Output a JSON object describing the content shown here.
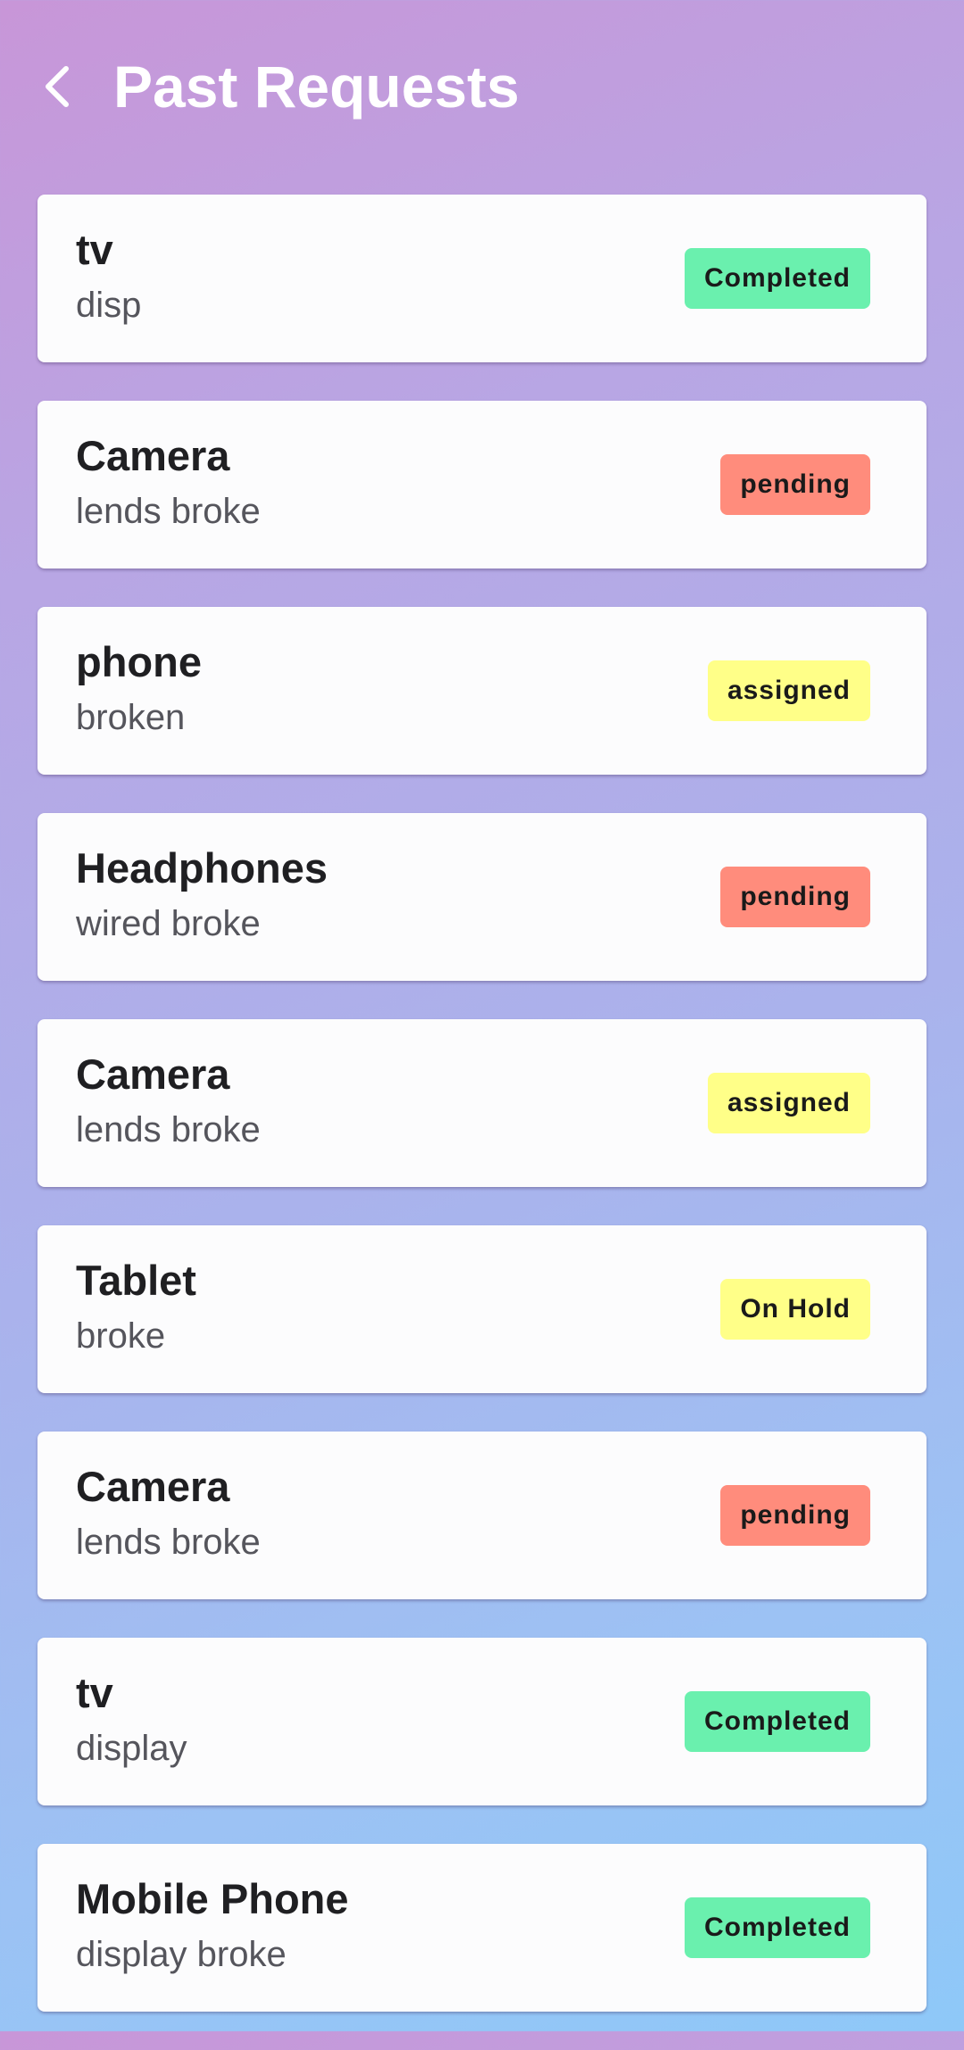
{
  "header": {
    "title": "Past Requests",
    "back_icon": "chevron-left-icon"
  },
  "status_colors": {
    "Completed": "#6af0ae",
    "pending": "#ff8c7c",
    "assigned": "#ffff88",
    "On Hold": "#ffff88"
  },
  "requests": [
    {
      "title": "tv",
      "description": "disp",
      "status": "Completed"
    },
    {
      "title": "Camera",
      "description": "lends broke",
      "status": "pending"
    },
    {
      "title": "phone",
      "description": "broken",
      "status": "assigned"
    },
    {
      "title": "Headphones",
      "description": "wired broke",
      "status": "pending"
    },
    {
      "title": "Camera",
      "description": "lends broke",
      "status": "assigned"
    },
    {
      "title": "Tablet",
      "description": "broke",
      "status": "On Hold"
    },
    {
      "title": "Camera",
      "description": "lends broke",
      "status": "pending"
    },
    {
      "title": "tv",
      "description": "display",
      "status": "Completed"
    },
    {
      "title": "Mobile Phone",
      "description": "display broke",
      "status": "Completed"
    }
  ]
}
